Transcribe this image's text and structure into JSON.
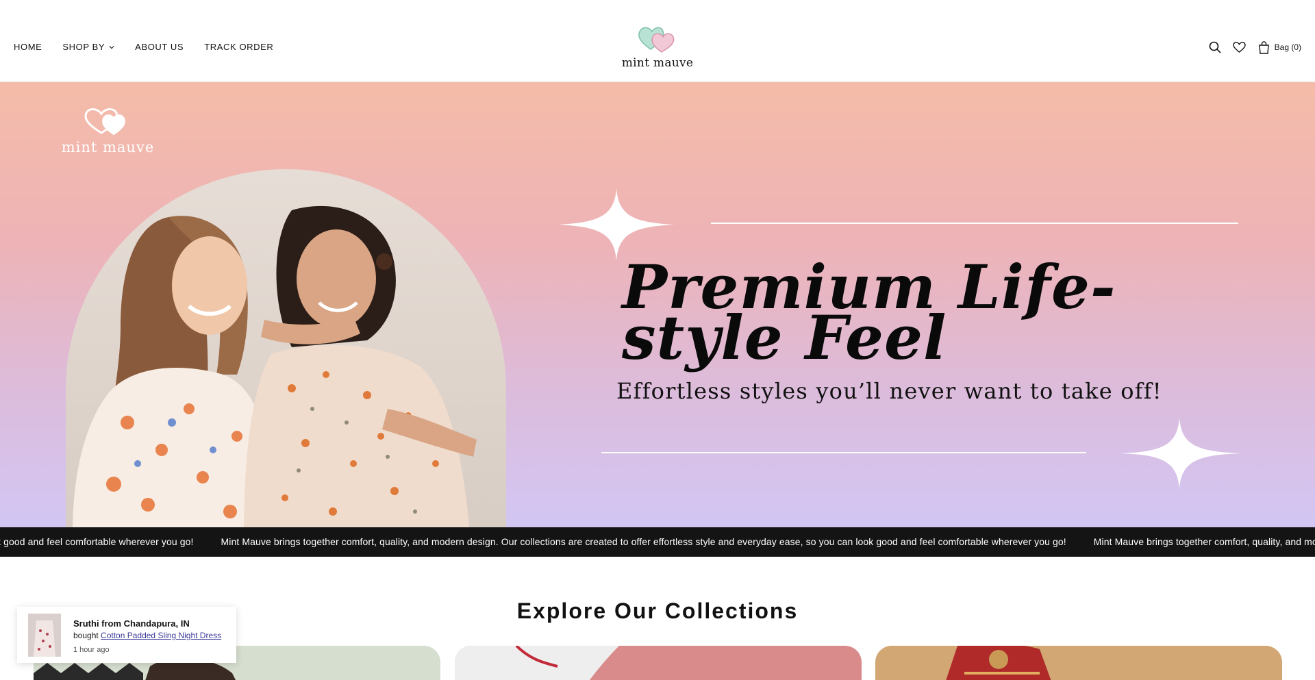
{
  "nav": {
    "items": [
      {
        "label": "HOME"
      },
      {
        "label": "SHOP BY"
      },
      {
        "label": "ABOUT US"
      },
      {
        "label": "TRACK ORDER"
      }
    ]
  },
  "brand": {
    "name": "mint mauve",
    "colors": {
      "mint": "#a8d8c8",
      "mauve": "#e6b6c8"
    }
  },
  "header_icons": {
    "search": "search-icon",
    "wishlist": "heart-icon",
    "bag": "bag-icon",
    "bag_label": "Bag (0)"
  },
  "hero": {
    "logo_text": "mint mauve",
    "title": "Premium Life-\nstyle Feel",
    "subtitle": "Effortless styles you’ll never want to take off!"
  },
  "marquee": {
    "segments": [
      "everyday ease, so you can look good and feel comfortable wherever you go!",
      "Mint Mauve brings together comfort, quality, and modern design. Our collections are created to offer effortless style and everyday ease, so you can look good and feel comfortable wherever you go!",
      "Mint Mauve brings together comfort, quality, and modern design. Our collections are created to offer effortless style and everyday ease, so you can look good and feel comfortable wherever you go!"
    ]
  },
  "collections": {
    "title": "Explore Our Collections"
  },
  "toast": {
    "name": "Sruthi from Chandapura, IN",
    "bought_prefix": "bought",
    "product": "Cotton Padded Sling Night Dress",
    "time": "1 hour ago"
  }
}
